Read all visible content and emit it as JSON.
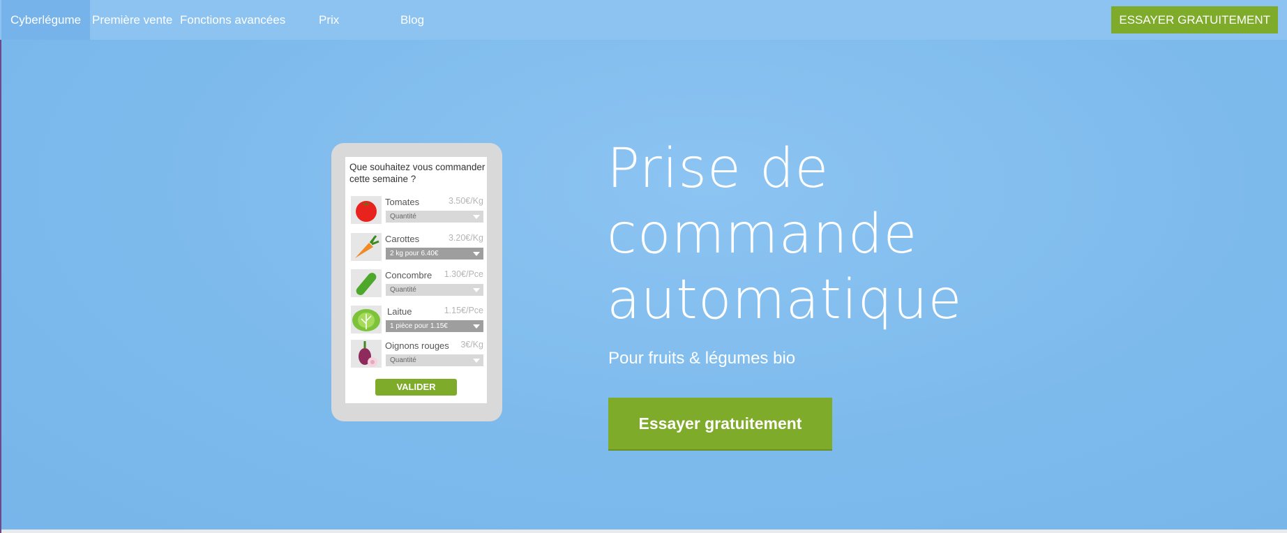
{
  "nav": {
    "brand": "Cyberlégume",
    "items": [
      "Première vente",
      "Fonctions avancées",
      "Prix",
      "Blog"
    ],
    "cta": "ESSAYER GRATUITEMENT"
  },
  "phone": {
    "question": "Que souhaitez vous commander cette semaine ?",
    "products": [
      {
        "name": "Tomates",
        "price": "3.50€/Kg",
        "select": "Quantité",
        "icon": "tomato-icon"
      },
      {
        "name": "Carottes",
        "price": "3.20€/Kg",
        "select": "2 kg pour 6.40€",
        "icon": "carrot-icon"
      },
      {
        "name": "Concombre",
        "price": "1.30€/Pce",
        "select": "Quantité",
        "icon": "cucumber-icon"
      },
      {
        "name": "Laitue",
        "price": "1.15€/Pce",
        "select": "1 pièce pour 1.15€",
        "icon": "lettuce-icon"
      },
      {
        "name": "Oignons rouges",
        "price": "3€/Kg",
        "select": "Quantité",
        "icon": "red-onion-icon"
      }
    ],
    "submit": "VALIDER"
  },
  "hero": {
    "title_line1": "Prise de",
    "title_line2": "commande",
    "title_line3": "automatique",
    "subtitle": "Pour fruits & légumes bio",
    "cta": "Essayer gratuitement"
  },
  "colors": {
    "background": "#7fbaec",
    "nav": "#8cc3f1",
    "accent_green": "#7fab2a"
  }
}
